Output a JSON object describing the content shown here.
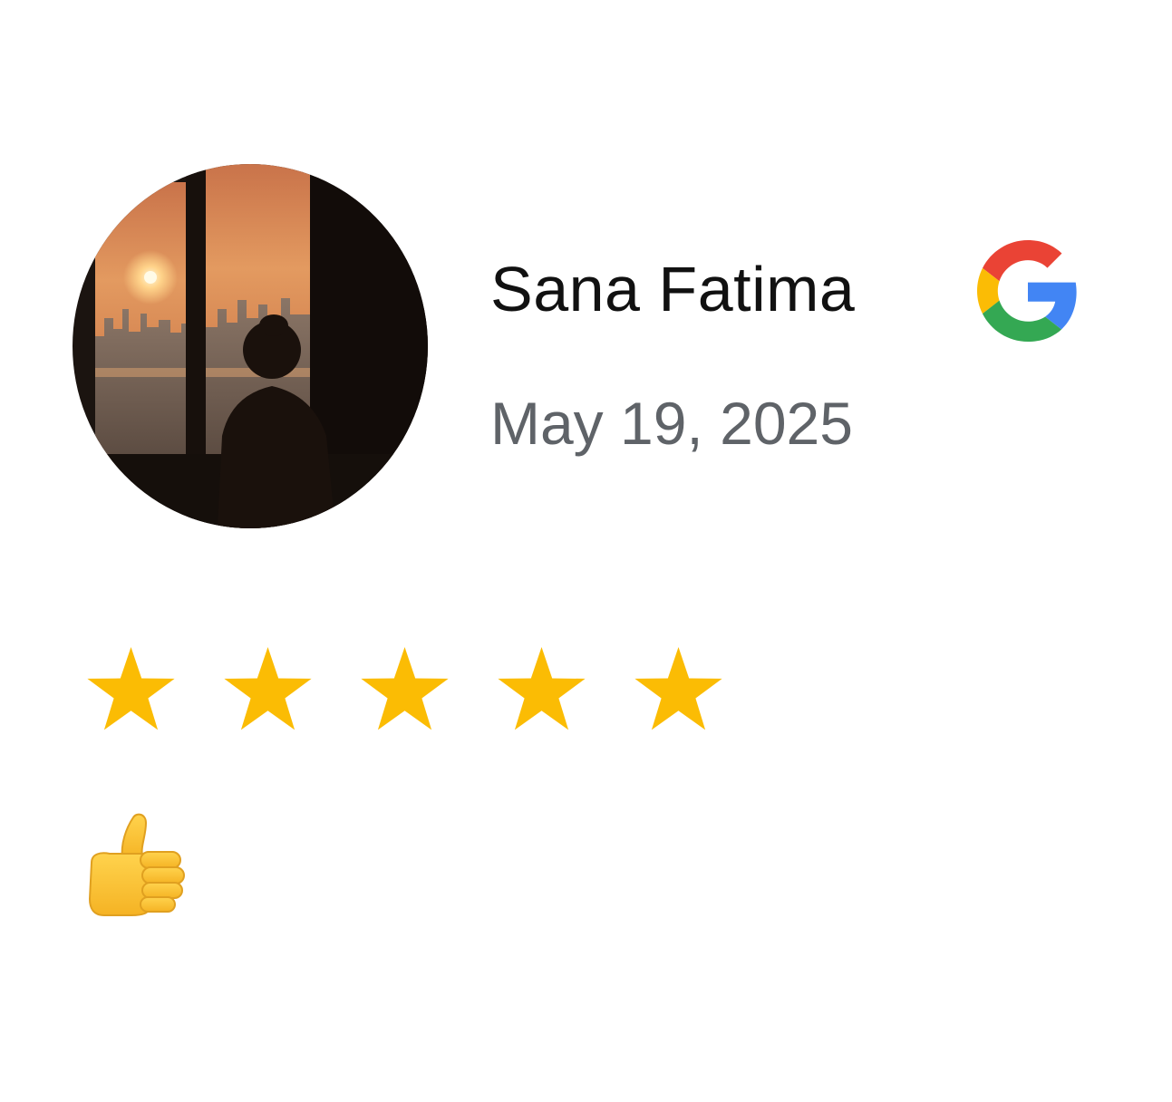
{
  "review": {
    "reviewer_name": "Sana Fatima",
    "date": "May 19, 2025",
    "source_icon": "google-g-icon",
    "rating": 5,
    "rating_max": 5,
    "star_color": "#FBBC04",
    "reaction_icon": "thumbs-up-icon"
  },
  "colors": {
    "google_blue": "#4285F4",
    "google_red": "#EA4335",
    "google_yellow": "#FBBC05",
    "google_green": "#34A853",
    "date_gray": "#5f6368"
  }
}
